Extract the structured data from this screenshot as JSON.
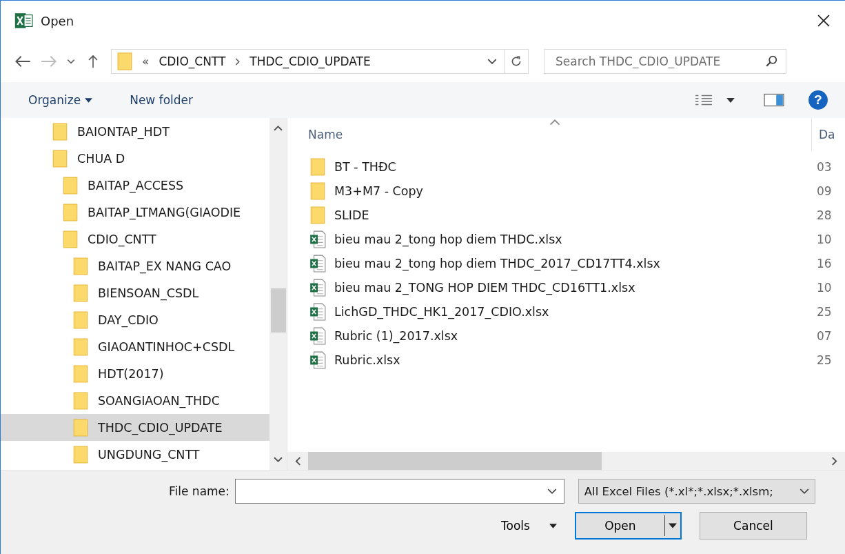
{
  "window": {
    "title": "Open"
  },
  "address": {
    "overflow": "«",
    "crumbs": [
      "CDIO_CNTT",
      "THDC_CDIO_UPDATE"
    ]
  },
  "search": {
    "placeholder": "Search THDC_CDIO_UPDATE"
  },
  "toolbar": {
    "organize": "Organize",
    "new_folder": "New folder",
    "help": "?"
  },
  "tree": [
    {
      "label": "BAIONTAP_HDT",
      "selected": false
    },
    {
      "label": "CHUA D",
      "selected": false,
      "children": [
        {
          "label": "BAITAP_ACCESS",
          "selected": false
        },
        {
          "label": "BAITAP_LTMANG(GIAODIE",
          "selected": false
        },
        {
          "label": "CDIO_CNTT",
          "selected": false,
          "children": [
            {
              "label": "BAITAP_EX NANG CAO",
              "selected": false
            },
            {
              "label": "BIENSOAN_CSDL",
              "selected": false
            },
            {
              "label": "DAY_CDIO",
              "selected": false
            },
            {
              "label": "GIAOANTINHOC+CSDL",
              "selected": false
            },
            {
              "label": "HDT(2017)",
              "selected": false
            },
            {
              "label": "SOANGIAOAN_THDC",
              "selected": false
            },
            {
              "label": "THDC_CDIO_UPDATE",
              "selected": true
            },
            {
              "label": "UNGDUNG_CNTT",
              "selected": false
            }
          ]
        }
      ]
    }
  ],
  "files": {
    "columns": [
      "Name",
      "Da"
    ],
    "rows": [
      {
        "kind": "folder",
        "name": "BT - THĐC",
        "date": "03"
      },
      {
        "kind": "folder",
        "name": "M3+M7 - Copy",
        "date": "09"
      },
      {
        "kind": "folder",
        "name": "SLIDE",
        "date": "28"
      },
      {
        "kind": "excel",
        "name": "bieu mau 2_tong hop diem THDC.xlsx",
        "date": "10"
      },
      {
        "kind": "excel",
        "name": "bieu mau 2_tong hop diem THDC_2017_CD17TT4.xlsx",
        "date": "16"
      },
      {
        "kind": "excel",
        "name": "bieu mau 2_TONG HOP DIEM THDC_CD16TT1.xlsx",
        "date": "10"
      },
      {
        "kind": "excel",
        "name": "LichGD_THDC_HK1_2017_CDIO.xlsx",
        "date": "25"
      },
      {
        "kind": "excel",
        "name": "Rubric (1)_2017.xlsx",
        "date": "07"
      },
      {
        "kind": "excel",
        "name": "Rubric.xlsx",
        "date": "25"
      }
    ]
  },
  "footer": {
    "file_name_label": "File name:",
    "file_type": "All Excel Files (*.xl*;*.xlsx;*.xlsm;",
    "tools": "Tools",
    "open": "Open",
    "cancel": "Cancel"
  }
}
